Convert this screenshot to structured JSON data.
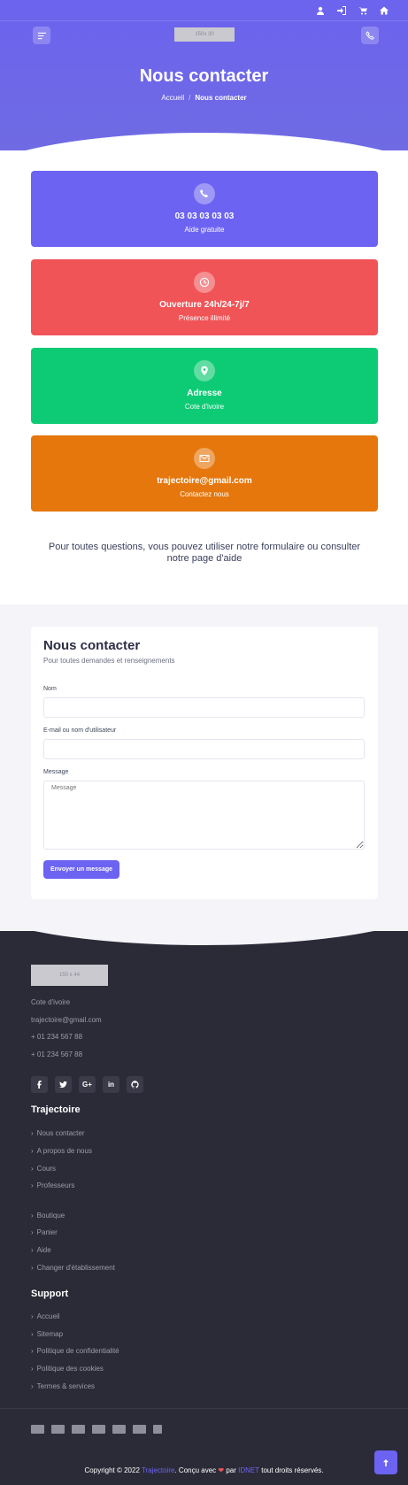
{
  "header": {
    "logo_placeholder": "150x 30",
    "title": "Nous contacter",
    "breadcrumb": {
      "home": "Accueil",
      "separator": "/",
      "current": "Nous contacter"
    },
    "topbar_icons": [
      "user-icon",
      "login-icon",
      "cart-icon",
      "home-icon"
    ]
  },
  "cards": [
    {
      "icon": "phone-icon",
      "title": "03 03 03 03 03",
      "subtitle": "Aide gratuite",
      "color": "#6c63f2"
    },
    {
      "icon": "clock-icon",
      "title": "Ouverture 24h/24-7j/7",
      "subtitle": "Présence illimité",
      "color": "#f05457"
    },
    {
      "icon": "map-pin-icon",
      "title": "Adresse",
      "subtitle": "Cote d'ivoire",
      "color": "#0dcb74"
    },
    {
      "icon": "envelope-icon",
      "title": "trajectoire@gmail.com",
      "subtitle": "Contactez nous",
      "color": "#e5770d"
    }
  ],
  "help": {
    "text": "Pour toutes questions, vous pouvez utiliser notre formulaire ou consulter",
    "link": "notre page d'aide"
  },
  "form": {
    "title": "Nous contacter",
    "subtitle": "Pour toutes demandes et renseignements",
    "name_label": "Nom",
    "name_value": "",
    "email_label": "E-mail ou nom d'utilisateur",
    "email_value": "",
    "message_label": "Message",
    "message_placeholder": "Message",
    "submit_label": "Envoyer un message"
  },
  "footer": {
    "logo_placeholder": "150 x 44",
    "info": [
      "Cote d'ivoire",
      "trajectoire@gmail.com",
      "+ 01 234 567 88",
      "+ 01 234 567 88"
    ],
    "socials": [
      "facebook-icon",
      "twitter-icon",
      "google-plus-icon",
      "linkedin-icon",
      "github-icon"
    ],
    "trajectoire_heading": "Trajectoire",
    "trajectoire_links": [
      "Nous contacter",
      "A propos de nous",
      "Cours",
      "Professeurs"
    ],
    "shop_links": [
      "Boutique",
      "Panier",
      "Aide",
      "Changer d'établissement"
    ],
    "support_heading": "Support",
    "support_links": [
      "Accueil",
      "Sitemap",
      "Politique de confidentialité",
      "Politique des cookies",
      "Termes & services"
    ],
    "payment_icons": [
      "amex-icon",
      "visa-icon",
      "card-icon",
      "mastercard-icon",
      "paypal-icon",
      "discover-icon",
      "stripe-icon"
    ],
    "copyright_prefix": "Copyright © 2022",
    "copyright_brand": "Trajectoire",
    "copyright_mid": ". Conçu avec",
    "copyright_heart": "❤",
    "copyright_by": "par",
    "copyright_company": "IDNET",
    "copyright_suffix": "tout droits réservés."
  }
}
